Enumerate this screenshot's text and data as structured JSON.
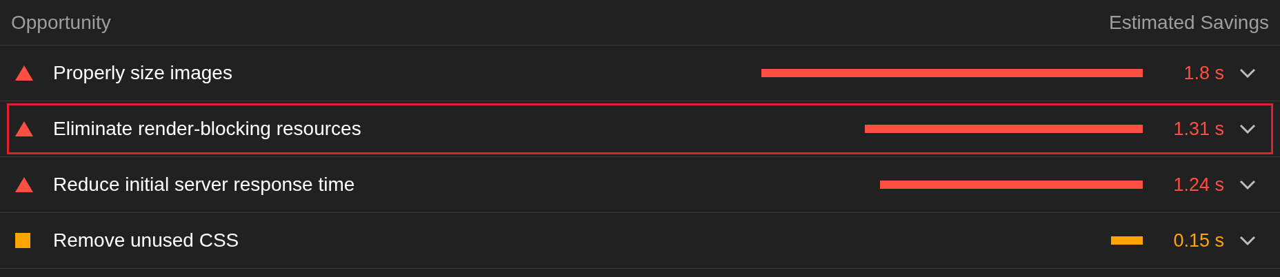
{
  "header": {
    "title": "Opportunity",
    "savings_label": "Estimated Savings"
  },
  "rows": [
    {
      "kind": "fail",
      "title": "Properly size images",
      "savings": "1.8 s",
      "selected": false,
      "expanded": false
    },
    {
      "kind": "fail",
      "title": "Eliminate render-blocking resources",
      "savings": "1.31 s",
      "selected": true,
      "expanded": false
    },
    {
      "kind": "fail",
      "title": "Reduce initial server response time",
      "savings": "1.24 s",
      "selected": false,
      "expanded": false
    },
    {
      "kind": "average",
      "title": "Remove unused CSS",
      "savings": "0.15 s",
      "selected": false,
      "expanded": false
    }
  ]
}
